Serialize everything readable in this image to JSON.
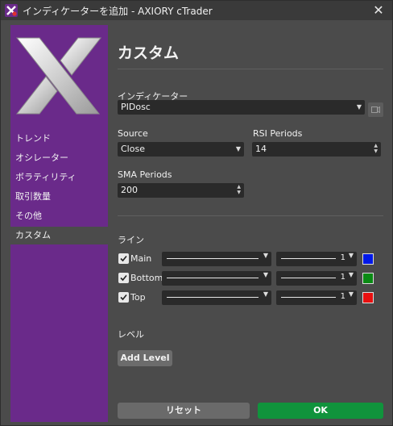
{
  "window": {
    "title": "インディケーターを追加 - AXIORY cTrader",
    "close_symbol": "✕"
  },
  "sidebar": {
    "items": [
      {
        "label": "トレンド"
      },
      {
        "label": "オシレーター"
      },
      {
        "label": "ボラティリティ"
      },
      {
        "label": "取引数量"
      },
      {
        "label": "その他"
      },
      {
        "label": "カスタム",
        "active": true
      }
    ]
  },
  "main": {
    "heading": "カスタム",
    "indicator": {
      "label": "インディケーター",
      "value": "PIDosc"
    },
    "source": {
      "label": "Source",
      "value": "Close"
    },
    "rsi_periods": {
      "label": "RSI Periods",
      "value": "14"
    },
    "sma_periods": {
      "label": "SMA Periods",
      "value": "200"
    },
    "lines_section": {
      "label": "ライン"
    },
    "lines": [
      {
        "name": "Main",
        "checked": true,
        "width": "1",
        "color": "#0018e8"
      },
      {
        "name": "Bottom",
        "checked": true,
        "width": "1",
        "color": "#0a8a14"
      },
      {
        "name": "Top",
        "checked": true,
        "width": "1",
        "color": "#e81010"
      }
    ],
    "levels_section": {
      "label": "レベル"
    },
    "add_level_label": "Add Level",
    "reset_label": "リセット",
    "ok_label": "OK"
  },
  "colors": {
    "sidebar": "#6a2a8a",
    "ok": "#10933c",
    "reset": "#6a6a6a"
  }
}
